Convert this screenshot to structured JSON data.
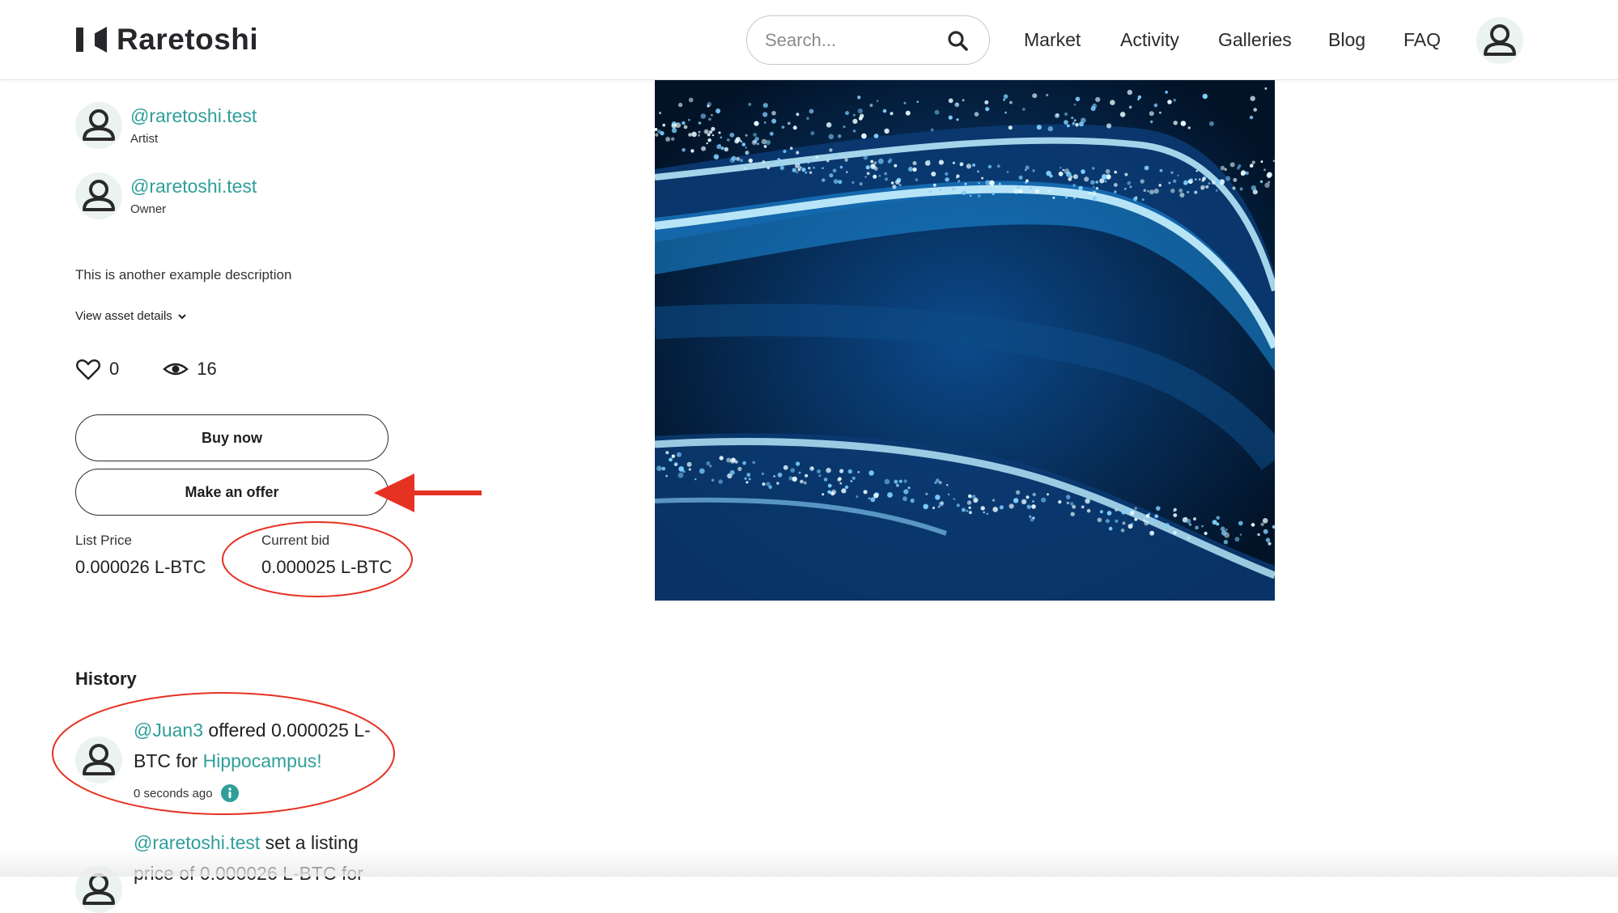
{
  "header": {
    "brand": "Raretoshi",
    "search_placeholder": "Search...",
    "nav": [
      "Market",
      "Activity",
      "Galleries",
      "Blog",
      "FAQ"
    ]
  },
  "asset": {
    "artist": {
      "handle": "@raretoshi.test",
      "role": "Artist"
    },
    "owner": {
      "handle": "@raretoshi.test",
      "role": "Owner"
    },
    "description": "This is another example description",
    "details_link": "View asset details",
    "likes": "0",
    "views": "16",
    "buy_label": "Buy now",
    "offer_label": "Make an offer",
    "list_price_label": "List Price",
    "list_price": "0.000026 L-BTC",
    "current_bid_label": "Current bid",
    "current_bid": "0.000025 L-BTC"
  },
  "history": {
    "title": "History",
    "items": [
      {
        "user": "@Juan3",
        "action": " offered 0.000025 L-BTC for ",
        "asset": "Hippocampus!",
        "time": "0 seconds ago"
      },
      {
        "user": "@raretoshi.test",
        "action": " set a listing price of 0.000026 L-BTC for"
      }
    ]
  },
  "colors": {
    "accent": "#2f9e9a",
    "annotation": "#e63223",
    "text": "#1f1f1f"
  },
  "icons": [
    "logo-icon",
    "search-icon",
    "user-icon",
    "heart-icon",
    "eye-icon",
    "chevron-down-icon",
    "info-icon"
  ]
}
